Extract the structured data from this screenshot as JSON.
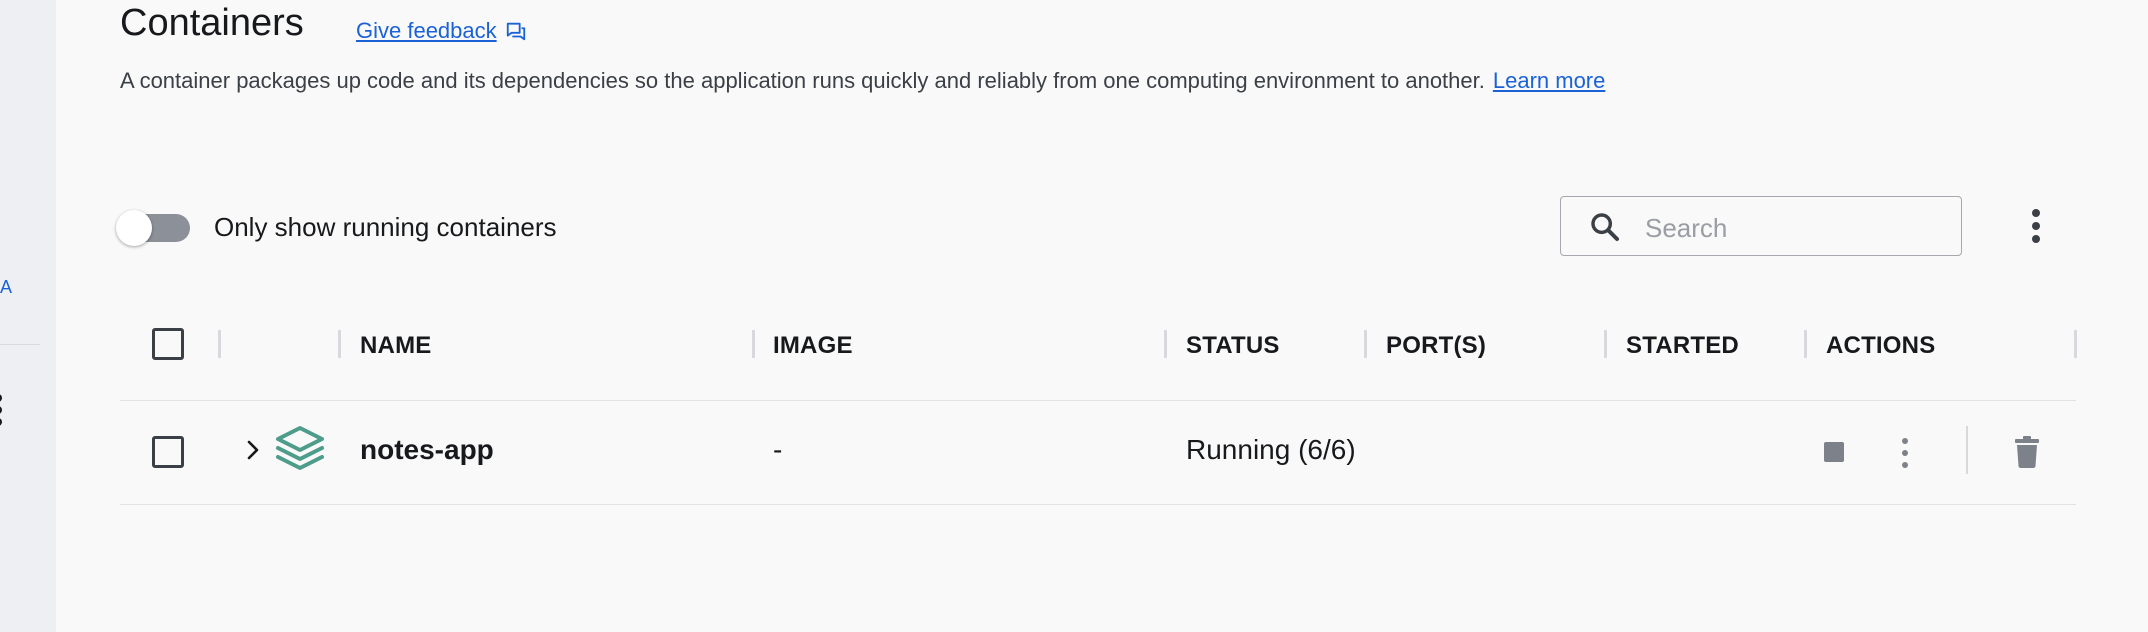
{
  "sidebar": {
    "nav_fragment": "A"
  },
  "header": {
    "title": "Containers",
    "feedback_label": "Give feedback",
    "description": "A container packages up code and its dependencies so the application runs quickly and reliably from one computing environment to another.",
    "learn_more_label": "Learn more"
  },
  "toolbar": {
    "toggle_label": "Only show running containers",
    "toggle_on": false,
    "search_placeholder": "Search"
  },
  "table": {
    "columns": [
      "NAME",
      "IMAGE",
      "STATUS",
      "PORT(S)",
      "STARTED",
      "ACTIONS"
    ],
    "rows": [
      {
        "name": "notes-app",
        "image": "-",
        "status": "Running (6/6)",
        "ports": "",
        "started": ""
      }
    ]
  },
  "colors": {
    "accent": "#1b62d6",
    "stack_icon": "#4e9d8a",
    "action_icon": "#7d8189"
  },
  "icons": {
    "feedback": "feedback-chat-icon",
    "search": "search-icon",
    "more": "kebab-menu-icon",
    "expand": "chevron-right-icon",
    "compose": "stack-layers-icon",
    "stop": "stop-icon",
    "delete": "trash-icon"
  }
}
